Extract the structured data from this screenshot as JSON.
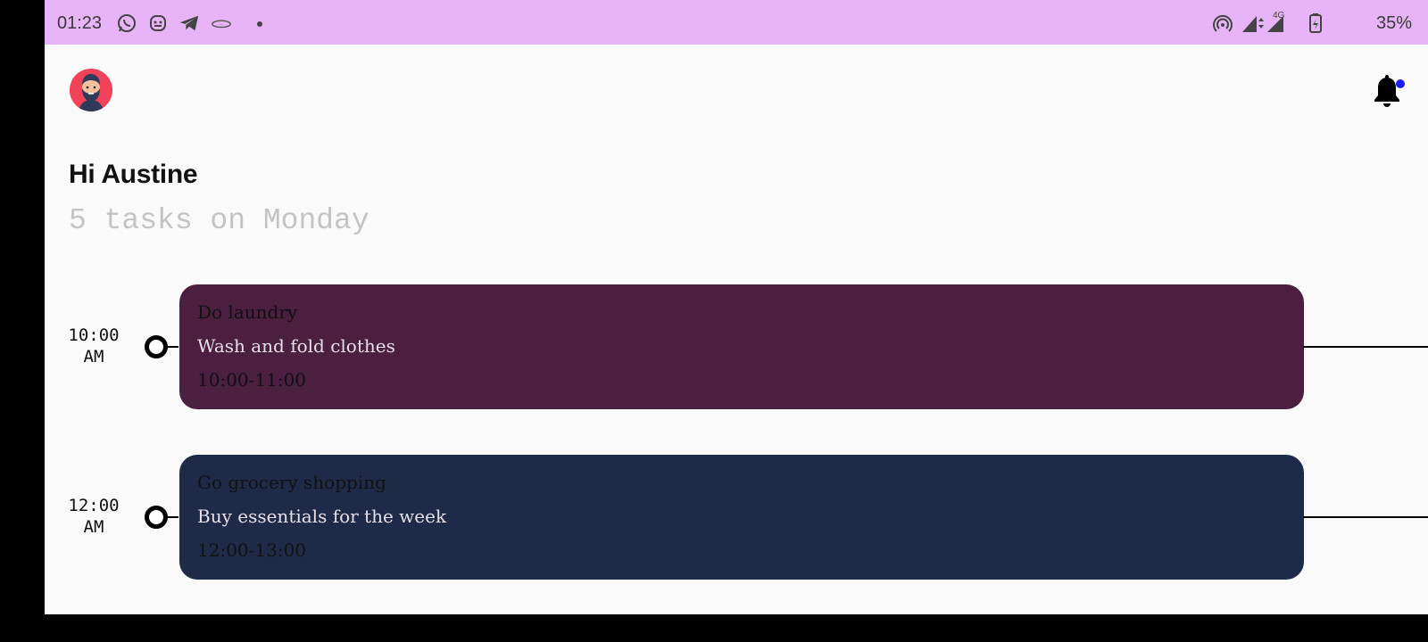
{
  "status_bar": {
    "time": "01:23",
    "battery": "35%",
    "network": "4G",
    "icons": [
      "whatsapp-icon",
      "bot-icon",
      "telegram-icon",
      "app-icon",
      "hotspot-icon",
      "signal-icon",
      "battery-icon"
    ]
  },
  "header": {
    "avatar": "avatar",
    "greeting": "Hi Austine",
    "subtitle": "5 tasks on Monday",
    "notification_icon": "bell-icon",
    "notification_dot_color": "#1a1aff"
  },
  "tasks": [
    {
      "time_line1": "10:00",
      "time_line2": "AM",
      "title": "Do laundry",
      "description": "Wash and fold clothes",
      "range": "10:00-11:00",
      "color": "#4a1f40"
    },
    {
      "time_line1": "12:00",
      "time_line2": "AM",
      "title": "Go grocery shopping",
      "description": "Buy essentials for the week",
      "range": "12:00-13:00",
      "color": "#1e2b48"
    }
  ]
}
